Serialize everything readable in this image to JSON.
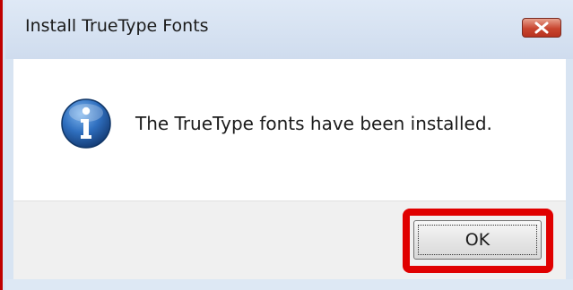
{
  "dialog": {
    "title": "Install TrueType Fonts",
    "close_icon": "close-icon",
    "message": "The TrueType fonts have been installed.",
    "info_icon": "information-icon",
    "ok_label": "OK"
  },
  "colors": {
    "highlight": "#e00000",
    "close_button": "#c8452f",
    "info_icon_blue": "#1f5fa8",
    "titlebar": "#dfe9f6"
  }
}
